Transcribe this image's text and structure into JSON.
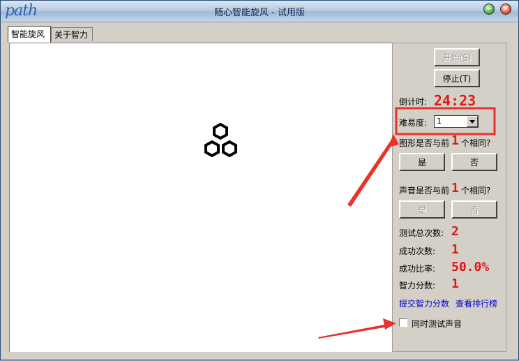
{
  "window": {
    "logo_text": "path",
    "title": "随心智能旋风 - 试用版"
  },
  "titlebar_buttons": {
    "minimize": {
      "icon": "minimize-icon",
      "glyph": "−",
      "color": "#33aa33"
    },
    "close": {
      "icon": "close-icon",
      "glyph": "×",
      "color": "#e03a1a"
    }
  },
  "tabs": [
    {
      "label": "智能旋风",
      "active": true
    },
    {
      "label": "关于智力",
      "active": false
    }
  ],
  "stimulus": {
    "icon": "hexagon-cluster-icon",
    "shape_count": 3
  },
  "controls": {
    "start_label": "开始(S)",
    "stop_label": "停止(T)",
    "countdown_label": "倒计时:",
    "countdown_value": "24:23",
    "difficulty_label": "难易度:",
    "difficulty_value": "1",
    "shape_question_prefix": "图形是否与前",
    "shape_question_n": "1",
    "shape_question_suffix": "个相同?",
    "shape_yes": "是",
    "shape_no": "否",
    "sound_question_prefix": "声音是否与前",
    "sound_question_n": "1",
    "sound_question_suffix": "个相同?",
    "sound_yes": "是",
    "sound_no": "否"
  },
  "stats": {
    "total_label": "测试总次数:",
    "total_value": "2",
    "success_label": "成功次数:",
    "success_value": "1",
    "ratio_label": "成功比率:",
    "ratio_value": "50.0%",
    "score_label": "智力分数:",
    "score_value": "1"
  },
  "links": {
    "submit": "提交智力分数",
    "ranking": "查看排行榜"
  },
  "options": {
    "sound_test_label": "同时测试声音",
    "sound_test_checked": false
  },
  "annotations": {
    "highlight_color": "#e8322a"
  }
}
